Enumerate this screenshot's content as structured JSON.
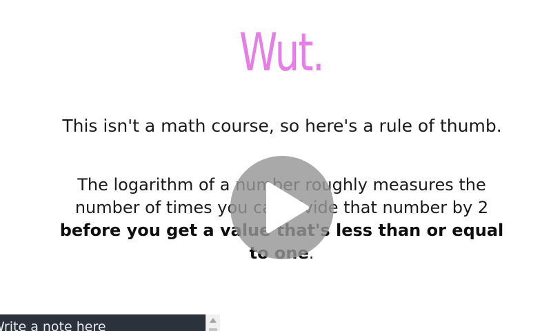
{
  "slide": {
    "title": "Wut.",
    "intro": "This isn't a math course, so here's a rule of thumb.",
    "paragraph_plain": "The logarithm of a number roughly measures the number of times you can divide that number by 2 ",
    "paragraph_bold": "before you get a value that's less than or equal to one",
    "paragraph_end": "."
  },
  "notes": {
    "placeholder": "Write a note here"
  },
  "colors": {
    "title": "#e57fe5",
    "text": "#1a1a1a",
    "notes_bar": "#2c323b",
    "play_overlay": "#969696"
  },
  "icons": {
    "play": "play-icon",
    "scroll_up": "chevron-up-icon"
  }
}
